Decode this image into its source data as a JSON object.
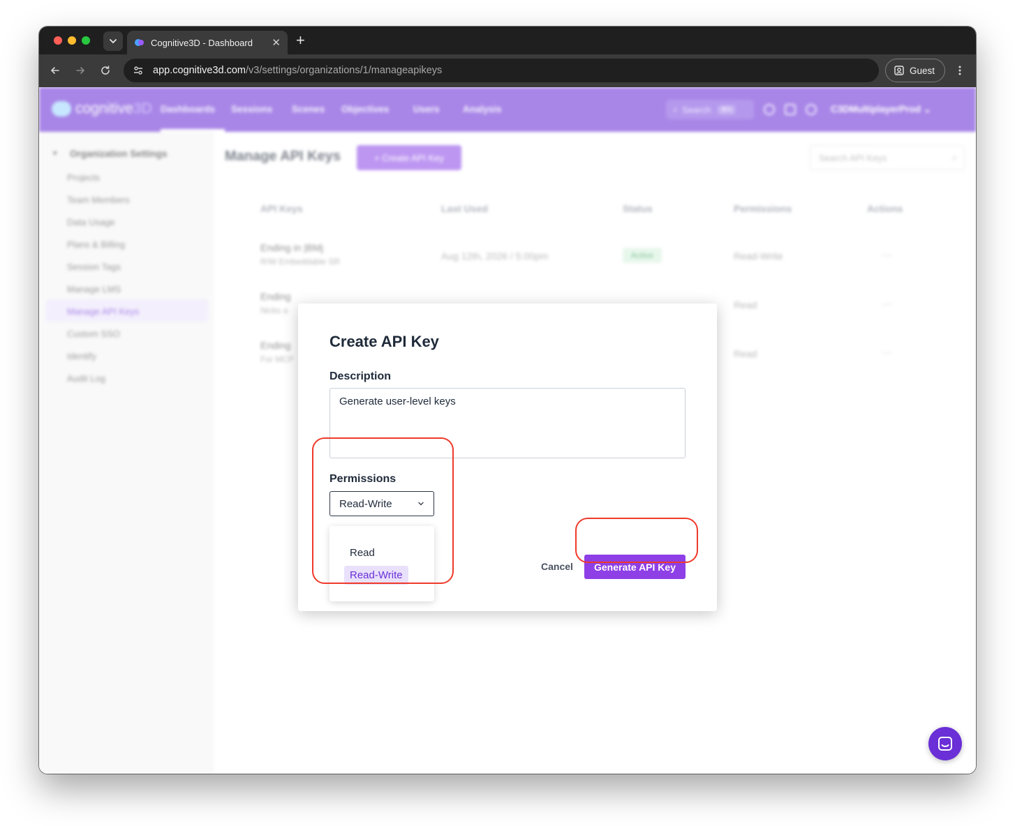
{
  "browser": {
    "tab_title": "Cognitive3D - Dashboard",
    "url_host": "app.cognitive3d.com",
    "url_path": "/v3/settings/organizations/1/manageapikeys",
    "profile_label": "Guest"
  },
  "app": {
    "brand_name": "cognitive",
    "brand_suffix": "3D",
    "nav": [
      "Dashboards",
      "Sessions",
      "Scenes",
      "Objectives",
      "Users",
      "Analysis"
    ],
    "search_placeholder": "Search",
    "search_shortcut": "⌘K",
    "org_name": "C3DMultiplayerProd",
    "accent_color": "#6a2fd6"
  },
  "sidebar": {
    "heading": "Organization Settings",
    "items": [
      "Projects",
      "Team Members",
      "Data Usage",
      "Plans & Billing",
      "Session Tags",
      "Manage LMS",
      "Manage API Keys",
      "Custom SSO",
      "Identify",
      "Audit Log"
    ],
    "active_item": "Manage API Keys"
  },
  "content": {
    "title": "Manage API Keys",
    "create_button": "+ Create API Key",
    "search_placeholder": "Search API Keys",
    "columns": [
      "API Keys",
      "Last Used",
      "Status",
      "Permissions",
      "Actions"
    ],
    "rows": [
      {
        "name": "Ending in |BMj",
        "sub": "R/W Embeddable SR",
        "last_used": "Aug 12th, 2026 / 5:00pm",
        "status": "Active",
        "permissions": "Read-Write",
        "actions": "···"
      },
      {
        "name": "Ending",
        "sub": "Nicks a",
        "last_used": "",
        "status": "",
        "permissions": "Read",
        "actions": "···"
      },
      {
        "name": "Ending",
        "sub": "For MCP",
        "last_used": "",
        "status": "",
        "permissions": "Read",
        "actions": "···"
      }
    ]
  },
  "modal": {
    "title": "Create API Key",
    "description_label": "Description",
    "description_value": "Generate user-level keys",
    "permissions_label": "Permissions",
    "permissions_selected": "Read-Write",
    "permission_options": [
      "Read",
      "Read-Write"
    ],
    "cancel_label": "Cancel",
    "generate_label": "Generate API Key",
    "highlight_color": "#ee3a2a"
  }
}
